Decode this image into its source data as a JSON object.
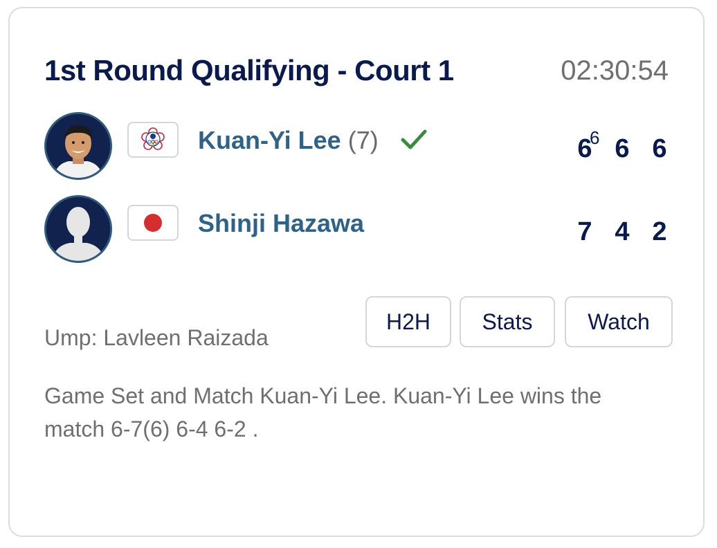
{
  "match": {
    "title": "1st Round Qualifying - Court 1",
    "time": "02:30:54",
    "umpire": "Ump: Lavleen Raizada",
    "summary": "Game Set and Match Kuan-Yi Lee. Kuan-Yi Lee wins the match 6-7(6) 6-4 6-2 ."
  },
  "players": [
    {
      "name": "Kuan-Yi Lee",
      "seed": "(7)",
      "flag_icon": "chinese-taipei-olympic-flag-icon",
      "winner": true,
      "scores": [
        "6",
        "6",
        "6"
      ],
      "tiebreak": "6"
    },
    {
      "name": "Shinji Hazawa",
      "seed": "",
      "flag_icon": "japan-flag-icon",
      "winner": false,
      "scores": [
        "7",
        "4",
        "2"
      ]
    }
  ],
  "buttons": {
    "h2h": "H2H",
    "stats": "Stats",
    "watch": "Watch"
  },
  "colors": {
    "title": "#0b1a4d",
    "player_name": "#2e6288",
    "check": "#3a8a3f",
    "japan_red": "#d42e2e"
  }
}
